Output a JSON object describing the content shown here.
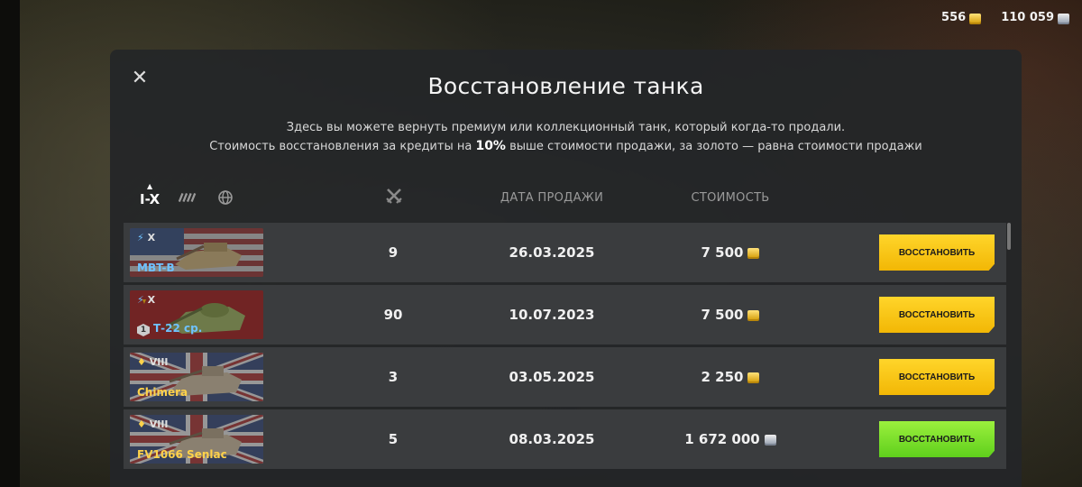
{
  "currency": {
    "gold": "556",
    "credits": "110 059"
  },
  "modal": {
    "title": "Восстановление танка",
    "desc_line1": "Здесь вы можете вернуть премиум или коллекционный танк, который когда-то продали.",
    "desc_line2_a": "Стоимость восстановления за кредиты на ",
    "desc_line2_b": "10%",
    "desc_line2_c": " выше стоимости продажи, за золото — равна стоимости продажи",
    "filter_tier": "I-X",
    "col_date": "ДАТА ПРОДАЖИ",
    "col_cost": "СТОИМОСТЬ"
  },
  "rows": [
    {
      "tier": "X",
      "name": "MBT-B",
      "name_color": "blue",
      "flag": "usa",
      "battles": "9",
      "date": "26.03.2025",
      "cost": "7 500",
      "currency": "gold",
      "button": "ВОССТАНОВИТЬ",
      "button_color": "gold"
    },
    {
      "tier": "X",
      "name": "Т-22 ср.",
      "name_color": "blue",
      "flag": "ussr",
      "battles": "90",
      "date": "10.07.2023",
      "cost": "7 500",
      "currency": "gold",
      "button": "ВОССТАНОВИТЬ",
      "button_color": "gold",
      "mastery": "1"
    },
    {
      "tier": "VIII",
      "name": "Chimera",
      "name_color": "gold",
      "flag": "uk",
      "battles": "3",
      "date": "03.05.2025",
      "cost": "2 250",
      "currency": "gold",
      "button": "ВОССТАНОВИТЬ",
      "button_color": "gold"
    },
    {
      "tier": "VIII",
      "name": "FV1066 Senlac",
      "name_color": "gold",
      "flag": "uk",
      "battles": "5",
      "date": "08.03.2025",
      "cost": "1 672 000",
      "currency": "credits",
      "button": "ВОССТАНОВИТЬ",
      "button_color": "green"
    }
  ],
  "colors": {
    "gold_button": "#f2b705",
    "green_button": "#5fcf1c",
    "premium_name": "#ffd24a",
    "collector_name": "#6fc2ff"
  }
}
